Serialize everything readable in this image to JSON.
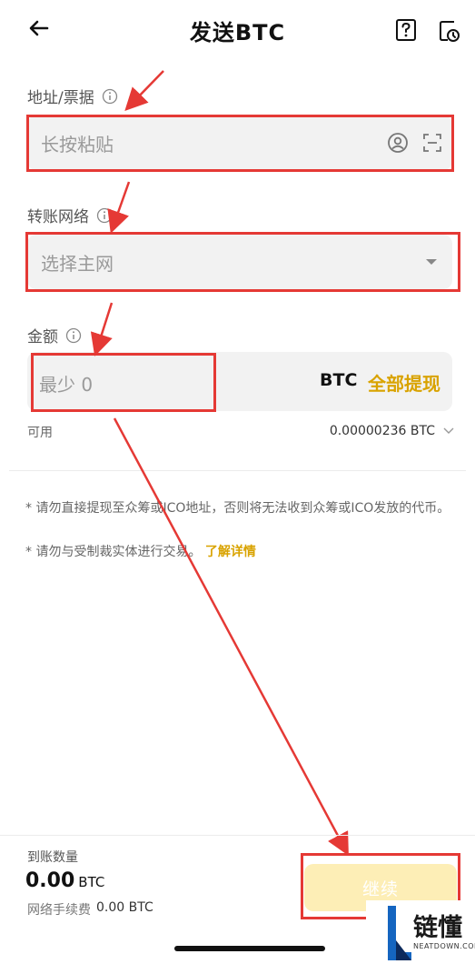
{
  "header": {
    "title": "发送BTC"
  },
  "address": {
    "label": "地址/票据",
    "placeholder": "长按粘贴"
  },
  "network": {
    "label": "转账网络",
    "placeholder": "选择主网"
  },
  "amount": {
    "label": "金额",
    "placeholder": "最少 0",
    "currency": "BTC",
    "max_label": "全部提现",
    "available_label": "可用",
    "available_value": "0.00000236 BTC"
  },
  "notes": {
    "line1": "* 请勿直接提现至众筹或ICO地址，否则将无法收到众筹或ICO发放的代币。",
    "line2": "* 请勿与受制裁实体进行交易。",
    "learn_more": "了解详情"
  },
  "footer": {
    "received_label": "到账数量",
    "received_amount": "0.00",
    "received_currency": "BTC",
    "fee_label": "网络手续费",
    "fee_value": "0.00 BTC",
    "continue_label": "继续"
  },
  "watermark": {
    "brand": "链懂",
    "sub": "NEATDOWN.COM"
  },
  "colors": {
    "accent": "#d9a300",
    "highlight": "#e53935",
    "field_bg": "#f2f2f2"
  }
}
